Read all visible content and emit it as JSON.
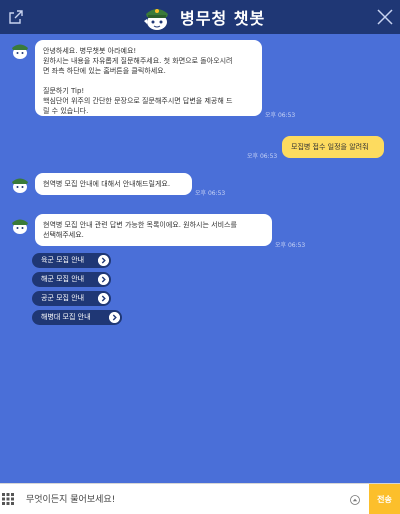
{
  "header": {
    "title": "병무청 챗봇",
    "colors": {
      "bar": "#1f3775",
      "background": "#4a6fd8"
    }
  },
  "messages": [
    {
      "from": "bot",
      "lines": [
        "안녕하세요. 병무챗봇 아라예요!",
        "원하시는 내용을 자유롭게 질문해주세요. 첫 화면으로 돌아오시려",
        "면 좌측 하단에 있는 홈버튼을 클릭하세요.",
        "",
        "질문하기 Tip!",
        "핵심단어 위주의 간단한 문장으로 질문해주시면 답변을 제공해 드",
        "릴 수 있습니다."
      ],
      "time": "오후 06:53"
    },
    {
      "from": "user",
      "lines": [
        "모집병 접수 일정을 알려줘"
      ],
      "time": "오후 06:53"
    },
    {
      "from": "bot",
      "lines": [
        "현역병 모집 안내에 대해서 안내해드릴게요."
      ],
      "time": "오후 06:53"
    },
    {
      "from": "bot",
      "lines": [
        "현역병 모집 안내 관련 답변 가능한 목록이에요. 원하시는 서비스를",
        "선택해주세요."
      ],
      "time": "오후 06:53"
    }
  ],
  "service_buttons": [
    "육군 모집 안내",
    "해군 모집 안내",
    "공군 모집 안내",
    "해병대 모집 안내"
  ],
  "footer": {
    "placeholder": "무엇이든지 물어보세요!",
    "send_label": "전송",
    "colors": {
      "send": "#fcbf2b",
      "user_bubble": "#fddb5f"
    }
  }
}
